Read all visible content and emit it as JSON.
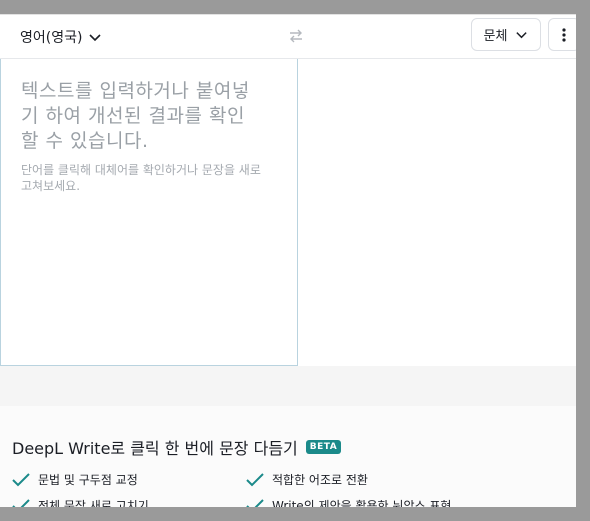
{
  "topbar": {
    "source_language": "영어(영국)",
    "style_label": "문체"
  },
  "editor": {
    "placeholder_main": "텍스트를 입력하거나 붙여넣기 하여 개선된 결과를 확인할 수 있습니다.",
    "placeholder_sub": "단어를 클릭해 대체어를 확인하거나 문장을 새로 고쳐보세요."
  },
  "promo": {
    "title": "DeepL Write로 클릭 한 번에 문장 다듬기",
    "badge": "BETA",
    "features": [
      "문법 및 구두점 교정",
      "적합한 어조로 전환",
      "전체 문장 새로 고치기",
      "Write의 제안을 활용한 뉘앙스 표현"
    ]
  },
  "colors": {
    "accent": "#1b8a8a",
    "check": "#1b8a8a",
    "placeholder": "#9aa0a6"
  }
}
